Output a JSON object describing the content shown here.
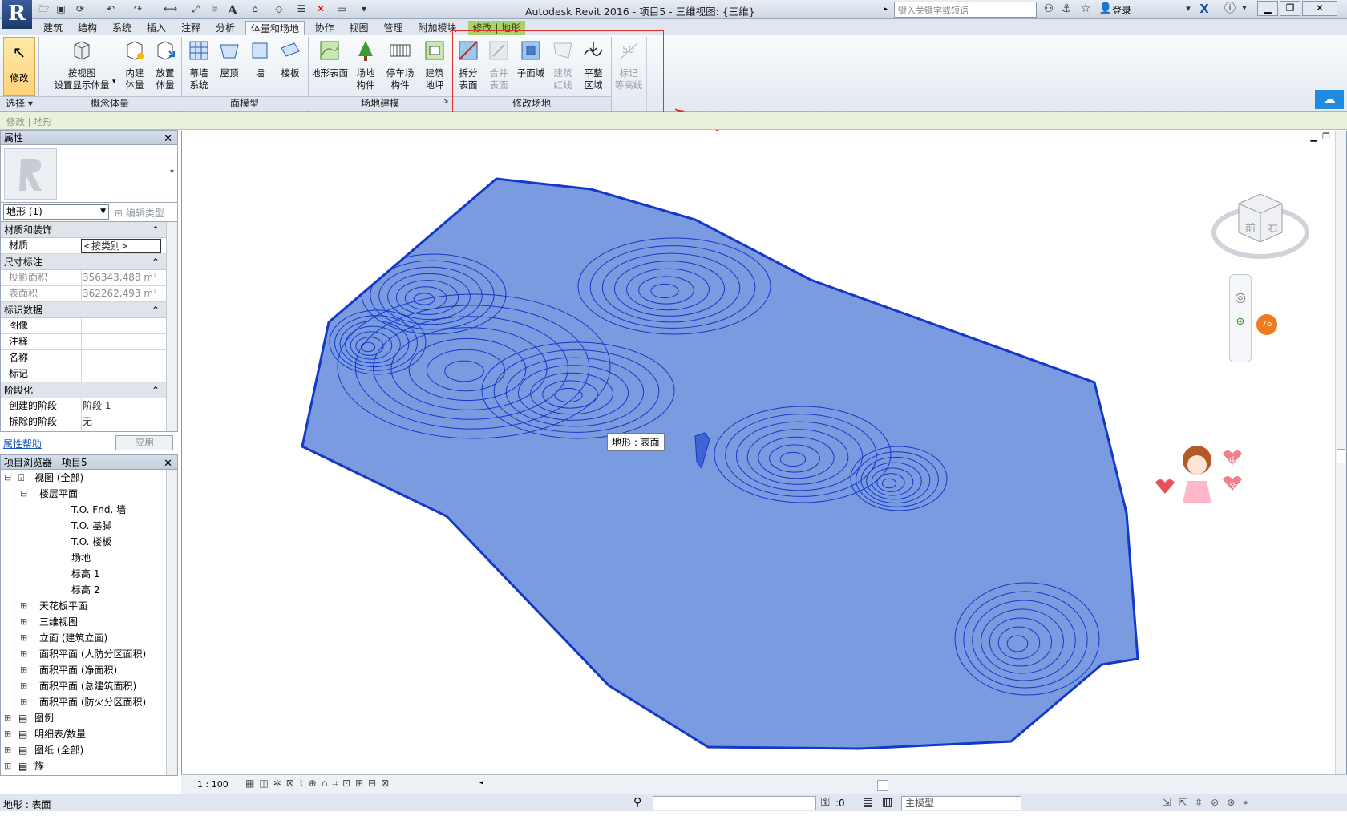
{
  "app": {
    "title": "Autodesk Revit 2016 -    项目5 - 三维视图: {三维}",
    "search_placeholder": "键入关键字或短语",
    "login": "登录"
  },
  "tabs": [
    "建筑",
    "结构",
    "系统",
    "插入",
    "注释",
    "分析",
    "体量和场地",
    "协作",
    "视图",
    "管理",
    "附加模块",
    "修改 | 地形"
  ],
  "ribbon": {
    "select": {
      "modify": "修改",
      "panel": "选择 ▾"
    },
    "conceptual": {
      "show_by_view": "按视图\n设置显示体量",
      "inplace": "内建\n体量",
      "place": "放置\n体量",
      "panel": "概念体量"
    },
    "face": {
      "curtain": "幕墙\n系统",
      "roof": "屋顶",
      "wall": "墙",
      "floor": "楼板",
      "panel": "面模型"
    },
    "site": {
      "toposurface": "地形表面",
      "site_comp": "场地\n构件",
      "parking": "停车场\n构件",
      "building_pad": "建筑\n地坪",
      "panel": "场地建模"
    },
    "modify_site": {
      "split": "拆分\n表面",
      "merge": "合并\n表面",
      "subregion": "子面域",
      "property_line": "建筑\n红线",
      "graded": "平整\n区域",
      "label": "标记\n等高线",
      "panel": "修改场地"
    }
  },
  "optbar": {
    "text": "修改 | 地形"
  },
  "properties": {
    "header": "属性",
    "type_selector": "地形 (1)",
    "edit_type": "编辑类型",
    "groups": [
      {
        "name": "材质和装饰",
        "rows": [
          {
            "k": "材质",
            "v": "<按类别>"
          }
        ]
      },
      {
        "name": "尺寸标注",
        "rows": [
          {
            "k": "投影面积",
            "v": "356343.488 m²"
          },
          {
            "k": "表面积",
            "v": "362262.493 m²"
          }
        ]
      },
      {
        "name": "标识数据",
        "rows": [
          {
            "k": "图像",
            "v": ""
          },
          {
            "k": "注释",
            "v": ""
          },
          {
            "k": "名称",
            "v": ""
          },
          {
            "k": "标记",
            "v": ""
          }
        ]
      },
      {
        "name": "阶段化",
        "rows": [
          {
            "k": "创建的阶段",
            "v": "阶段 1"
          },
          {
            "k": "拆除的阶段",
            "v": "无"
          }
        ]
      }
    ],
    "help": "属性帮助",
    "apply": "应用"
  },
  "browser": {
    "header": "项目浏览器 - 项目5",
    "items": [
      {
        "label": "视图 (全部)",
        "level": 0
      },
      {
        "label": "楼层平面",
        "level": 1
      },
      {
        "label": "T.O. Fnd. 墙",
        "level": 2
      },
      {
        "label": "T.O. 基脚",
        "level": 2
      },
      {
        "label": "T.O. 楼板",
        "level": 2
      },
      {
        "label": "场地",
        "level": 2
      },
      {
        "label": "标高 1",
        "level": 2
      },
      {
        "label": "标高 2",
        "level": 2
      },
      {
        "label": "天花板平面",
        "level": 1
      },
      {
        "label": "三维视图",
        "level": 1
      },
      {
        "label": "立面 (建筑立面)",
        "level": 1
      },
      {
        "label": "面积平面 (人防分区面积)",
        "level": 1
      },
      {
        "label": "面积平面 (净面积)",
        "level": 1
      },
      {
        "label": "面积平面 (总建筑面积)",
        "level": 1
      },
      {
        "label": "面积平面 (防火分区面积)",
        "level": 1
      },
      {
        "label": "图例",
        "level": 0
      },
      {
        "label": "明细表/数量",
        "level": 0
      },
      {
        "label": "图纸 (全部)",
        "level": 0
      },
      {
        "label": "族",
        "level": 0
      }
    ]
  },
  "view": {
    "tooltip": "地形 : 表面",
    "scale": "1 : 100",
    "cube_front": "前",
    "cube_right": "右",
    "mascot_a": "中",
    "mascot_b": "奖",
    "badge": "76"
  },
  "status": {
    "left": "地形 : 表面",
    "zero": ":0",
    "model": "主模型"
  },
  "colors": {
    "terrain_fill": "#7b9be0",
    "terrain_stroke": "#1438c8",
    "context_tab": "#a9d36a",
    "highlight": "#e03030"
  }
}
